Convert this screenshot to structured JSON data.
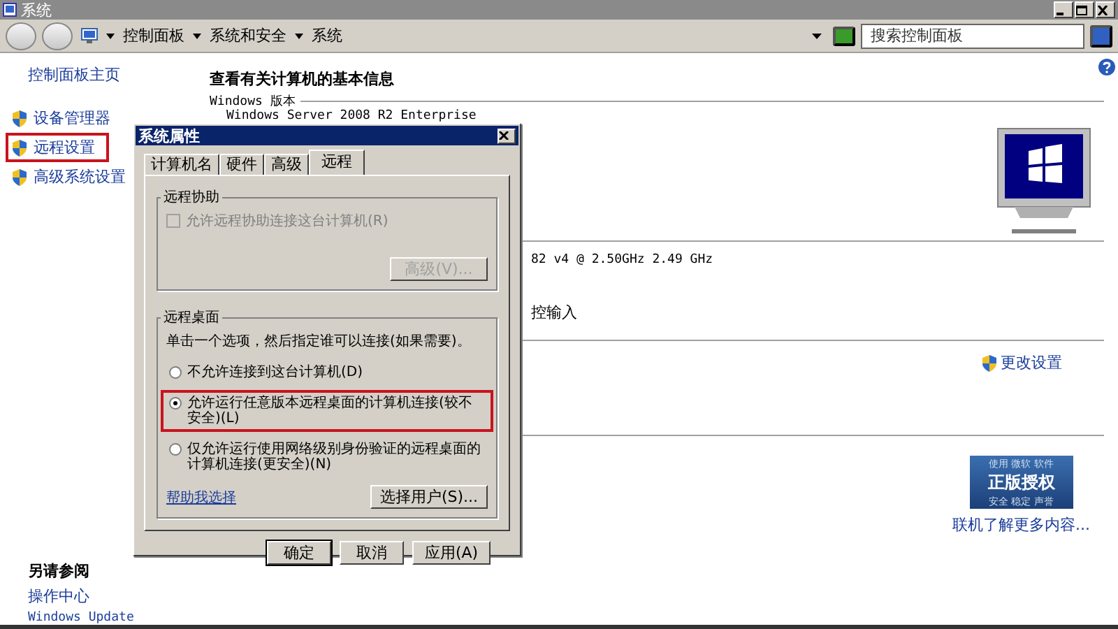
{
  "window": {
    "title": "系统"
  },
  "address": {
    "breadcrumbs": [
      "控制面板",
      "系统和安全",
      "系统"
    ],
    "search_placeholder": "搜索控制面板"
  },
  "sidebar": {
    "home": "控制面板主页",
    "items": [
      {
        "label": "设备管理器",
        "highlighted": false
      },
      {
        "label": "远程设置",
        "highlighted": true
      },
      {
        "label": "高级系统设置",
        "highlighted": false
      }
    ],
    "see_also_title": "另请参阅",
    "see_also": [
      "操作中心",
      "Windows Update"
    ]
  },
  "main": {
    "heading": "查看有关计算机的基本信息",
    "edition_label": "Windows 版本",
    "edition": "Windows Server 2008 R2 Enterprise",
    "processor_fragment": "82 v4 @ 2.50GHz   2.49 GHz",
    "input_fragment": "控输入",
    "change_settings": "更改设置",
    "genuine": {
      "top": "使用 微软 软件",
      "title": "正版授权",
      "bottom": "安全 稳定 声誉"
    },
    "learn_more": "联机了解更多内容..."
  },
  "dialog": {
    "title": "系统属性",
    "tabs": [
      {
        "label": "计算机名",
        "selected": false
      },
      {
        "label": "硬件",
        "selected": false
      },
      {
        "label": "高级",
        "selected": false
      },
      {
        "label": "远程",
        "selected": true
      }
    ],
    "assistance": {
      "title": "远程协助",
      "checkbox": {
        "label": "允许远程协助连接这台计算机(R)",
        "checked": false,
        "disabled": true
      },
      "advanced": {
        "label": "高级(V)...",
        "disabled": true
      }
    },
    "desktop": {
      "title": "远程桌面",
      "instruction": "单击一个选项，然后指定谁可以连接(如果需要)。",
      "options": [
        {
          "label": "不允许连接到这台计算机(D)",
          "selected": false,
          "highlighted": false
        },
        {
          "label": "允许运行任意版本远程桌面的计算机连接(较不安全)(L)",
          "selected": true,
          "highlighted": true
        },
        {
          "label": "仅允许运行使用网络级别身份验证的远程桌面的计算机连接(更安全)(N)",
          "selected": false,
          "highlighted": false
        }
      ],
      "help_link": "帮助我选择",
      "select_users": "选择用户(S)..."
    },
    "buttons": [
      {
        "label": "确定",
        "default": true
      },
      {
        "label": "取消",
        "default": false
      },
      {
        "label": "应用(A)",
        "default": false
      }
    ]
  }
}
